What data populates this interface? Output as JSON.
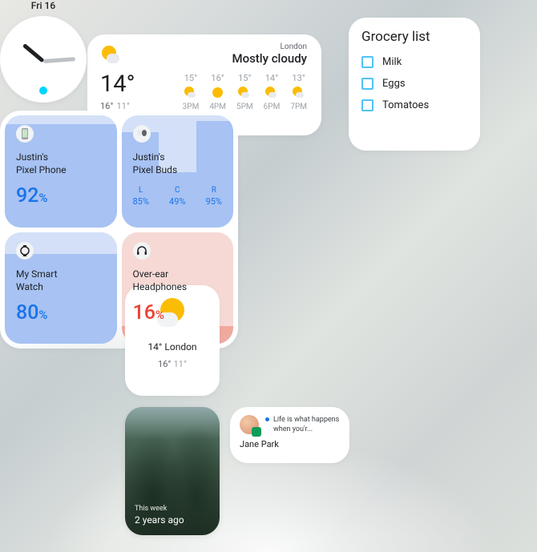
{
  "grocery": {
    "title": "Grocery list",
    "items": [
      "Milk",
      "Eggs",
      "Tomatoes"
    ]
  },
  "weather_large": {
    "location": "London",
    "condition": "Mostly cloudy",
    "current_temp": "14°",
    "high": "16°",
    "low": "11°",
    "forecast": [
      {
        "temp": "15°",
        "time": "3PM"
      },
      {
        "temp": "16°",
        "time": "4PM"
      },
      {
        "temp": "15°",
        "time": "5PM"
      },
      {
        "temp": "14°",
        "time": "6PM"
      },
      {
        "temp": "13°",
        "time": "7PM"
      }
    ]
  },
  "clock": {
    "date": "Fri 16"
  },
  "battery": {
    "devices": [
      {
        "name_l1": "Justin's",
        "name_l2": "Pixel Phone",
        "pct": "92",
        "pct_unit": "%",
        "fill": 92,
        "color": "blue",
        "icon": "phone-icon"
      },
      {
        "name_l1": "Justin's",
        "name_l2": "Pixel Buds",
        "color": "blue",
        "icon": "earbuds-icon",
        "buds": [
          {
            "label": "L",
            "value": "85%",
            "fill": 85
          },
          {
            "label": "C",
            "value": "49%",
            "fill": 49
          },
          {
            "label": "R",
            "value": "95%",
            "fill": 95
          }
        ]
      },
      {
        "name_l1": "My Smart",
        "name_l2": "Watch",
        "pct": "80",
        "pct_unit": "%",
        "fill": 80,
        "color": "blue",
        "icon": "watch-icon"
      },
      {
        "name_l1": "Over-ear",
        "name_l2": "Headphones",
        "pct": "16",
        "pct_unit": "%",
        "fill": 16,
        "color": "red",
        "icon": "headphones-icon"
      }
    ]
  },
  "weather_small": {
    "temp_city": "14° London",
    "high": "16°",
    "low": "11°"
  },
  "memory": {
    "subtitle": "This week",
    "title": "2 years ago"
  },
  "message": {
    "preview": "Life is what happens when you'r...",
    "sender": "Jane Park"
  }
}
